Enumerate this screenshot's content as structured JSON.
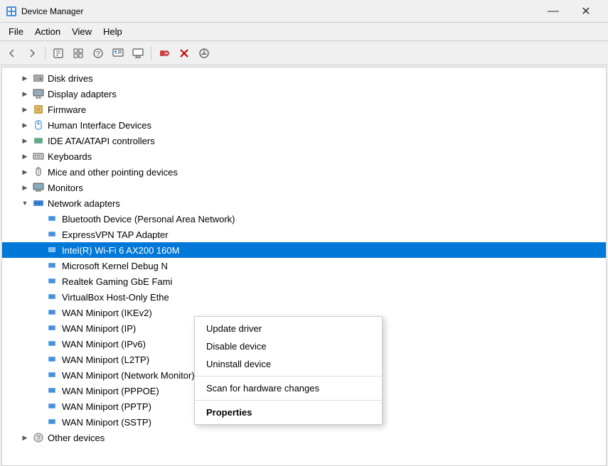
{
  "titleBar": {
    "icon": "⚙",
    "title": "Device Manager",
    "minimizeLabel": "—",
    "closeLabel": "✕"
  },
  "menuBar": {
    "items": [
      "File",
      "Action",
      "View",
      "Help"
    ]
  },
  "toolbar": {
    "buttons": [
      "◀",
      "▶",
      "📋",
      "📄",
      "❓",
      "📋",
      "💻",
      "🖨",
      "✖",
      "⬇"
    ]
  },
  "tree": {
    "items": [
      {
        "id": "disk-drives",
        "label": "Disk drives",
        "level": 1,
        "expanded": false,
        "icon": "disk"
      },
      {
        "id": "display-adapters",
        "label": "Display adapters",
        "level": 1,
        "expanded": false,
        "icon": "display"
      },
      {
        "id": "firmware",
        "label": "Firmware",
        "level": 1,
        "expanded": false,
        "icon": "firmware"
      },
      {
        "id": "hid",
        "label": "Human Interface Devices",
        "level": 1,
        "expanded": false,
        "icon": "hid"
      },
      {
        "id": "ide",
        "label": "IDE ATA/ATAPI controllers",
        "level": 1,
        "expanded": false,
        "icon": "ide"
      },
      {
        "id": "keyboards",
        "label": "Keyboards",
        "level": 1,
        "expanded": false,
        "icon": "keyboard"
      },
      {
        "id": "mice",
        "label": "Mice and other pointing devices",
        "level": 1,
        "expanded": false,
        "icon": "mouse"
      },
      {
        "id": "monitors",
        "label": "Monitors",
        "level": 1,
        "expanded": false,
        "icon": "monitor"
      },
      {
        "id": "network",
        "label": "Network adapters",
        "level": 1,
        "expanded": true,
        "icon": "network"
      },
      {
        "id": "bt",
        "label": "Bluetooth Device (Personal Area Network)",
        "level": 2,
        "expanded": false,
        "icon": "network-card"
      },
      {
        "id": "expressvpn",
        "label": "ExpressVPN TAP Adapter",
        "level": 2,
        "expanded": false,
        "icon": "network-card"
      },
      {
        "id": "intel-wifi",
        "label": "Intel(R) Wi-Fi 6 AX200 160M",
        "level": 2,
        "expanded": false,
        "icon": "network-card",
        "selected": true
      },
      {
        "id": "ms-kernel",
        "label": "Microsoft Kernel Debug N",
        "level": 2,
        "expanded": false,
        "icon": "network-card"
      },
      {
        "id": "realtek",
        "label": "Realtek Gaming GbE Fami",
        "level": 2,
        "expanded": false,
        "icon": "network-card"
      },
      {
        "id": "vbox",
        "label": "VirtualBox Host-Only Ethe",
        "level": 2,
        "expanded": false,
        "icon": "network-card"
      },
      {
        "id": "wan-ikev2",
        "label": "WAN Miniport (IKEv2)",
        "level": 2,
        "expanded": false,
        "icon": "network-card"
      },
      {
        "id": "wan-ip",
        "label": "WAN Miniport (IP)",
        "level": 2,
        "expanded": false,
        "icon": "network-card"
      },
      {
        "id": "wan-ipv6",
        "label": "WAN Miniport (IPv6)",
        "level": 2,
        "expanded": false,
        "icon": "network-card"
      },
      {
        "id": "wan-l2tp",
        "label": "WAN Miniport (L2TP)",
        "level": 2,
        "expanded": false,
        "icon": "network-card"
      },
      {
        "id": "wan-nm",
        "label": "WAN Miniport (Network Monitor)",
        "level": 2,
        "expanded": false,
        "icon": "network-card"
      },
      {
        "id": "wan-pppoe",
        "label": "WAN Miniport (PPPOE)",
        "level": 2,
        "expanded": false,
        "icon": "network-card"
      },
      {
        "id": "wan-pptp",
        "label": "WAN Miniport (PPTP)",
        "level": 2,
        "expanded": false,
        "icon": "network-card"
      },
      {
        "id": "wan-sstp",
        "label": "WAN Miniport (SSTP)",
        "level": 2,
        "expanded": false,
        "icon": "network-card"
      },
      {
        "id": "other",
        "label": "Other devices",
        "level": 1,
        "expanded": false,
        "icon": "other"
      }
    ]
  },
  "contextMenu": {
    "items": [
      {
        "id": "update-driver",
        "label": "Update driver",
        "bold": false,
        "separator": false
      },
      {
        "id": "disable-device",
        "label": "Disable device",
        "bold": false,
        "separator": false
      },
      {
        "id": "uninstall-device",
        "label": "Uninstall device",
        "bold": false,
        "separator": false
      },
      {
        "id": "sep1",
        "label": "",
        "separator": true
      },
      {
        "id": "scan-changes",
        "label": "Scan for hardware changes",
        "bold": false,
        "separator": false
      },
      {
        "id": "sep2",
        "label": "",
        "separator": true
      },
      {
        "id": "properties",
        "label": "Properties",
        "bold": true,
        "separator": false
      }
    ]
  }
}
